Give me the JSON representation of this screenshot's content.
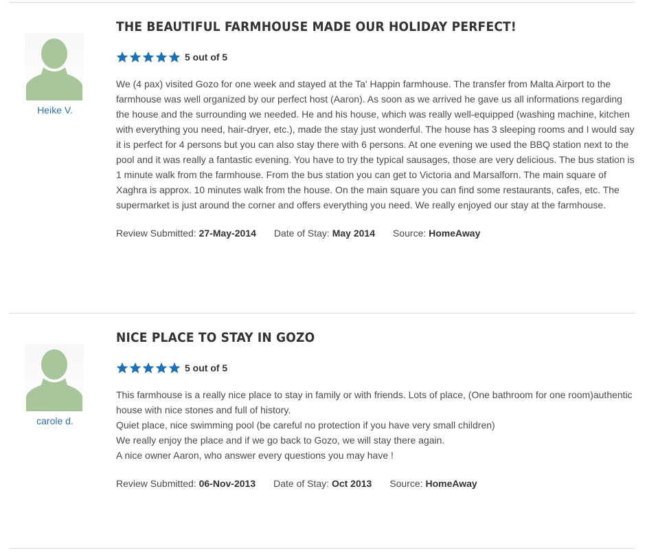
{
  "reviews": [
    {
      "reviewer": "Heike V.",
      "title": "THE BEAUTIFUL FARMHOUSE MADE OUR HOLIDAY PERFECT!",
      "rating": 5,
      "rating_text": "5 out of 5",
      "body": [
        "We (4 pax) visited Gozo for one week and stayed at the Ta' Happin farmhouse. The transfer from Malta Airport to the farmhouse was well organized by our perfect host (Aaron). As soon as we arrived he gave us all informations regarding the house and the surrounding we needed. He and his house, which was really well-equipped (washing machine, kitchen with everything you need, hair-dryer, etc.), made the stay just wonderful. The house has 3 sleeping rooms and I would say it is perfect for 4 persons but you can also stay there with 6 persons. At one evening we used the BBQ station next to the pool and it was really a fantastic evening. You have to try the typical sausages, those are very delicious. The bus station is 1 minute walk from the farmhouse. From the bus station you can get to Victoria and Marsalforn. The main square of Xaghra is approx. 10 minutes walk from the house. On the main square you can find some restaurants, cafes, etc. The supermarket is just around the corner and offers everything you need. We really enjoyed our stay at the farmhouse."
      ],
      "submitted_label": "Review Submitted:",
      "submitted": "27-May-2014",
      "stay_label": "Date of Stay:",
      "stay": "May 2014",
      "source_label": "Source:",
      "source": "HomeAway"
    },
    {
      "reviewer": "carole d.",
      "title": "NICE PLACE TO STAY IN GOZO",
      "rating": 5,
      "rating_text": "5 out of 5",
      "body": [
        "This farmhouse is a really nice place to stay in family or with friends. Lots of place, (One bathroom for one room)authentic house with nice stones and full of history.",
        "Quiet place, nice swimming pool (be careful no protection if you have very small children)",
        "We really enjoy the place and if we go back to Gozo, we will stay there again.",
        "A nice owner Aaron, who answer every questions you may have !"
      ],
      "submitted_label": "Review Submitted:",
      "submitted": "06-Nov-2013",
      "stay_label": "Date of Stay:",
      "stay": "Oct 2013",
      "source_label": "Source:",
      "source": "HomeAway"
    }
  ],
  "colors": {
    "star": "#1f6fb5",
    "name_link": "#2f6fa5",
    "avatar_fill": "#a8c49a",
    "divider": "#dcdcdc"
  },
  "icons": {
    "avatar": "user-silhouette-icon",
    "star": "star-icon"
  }
}
